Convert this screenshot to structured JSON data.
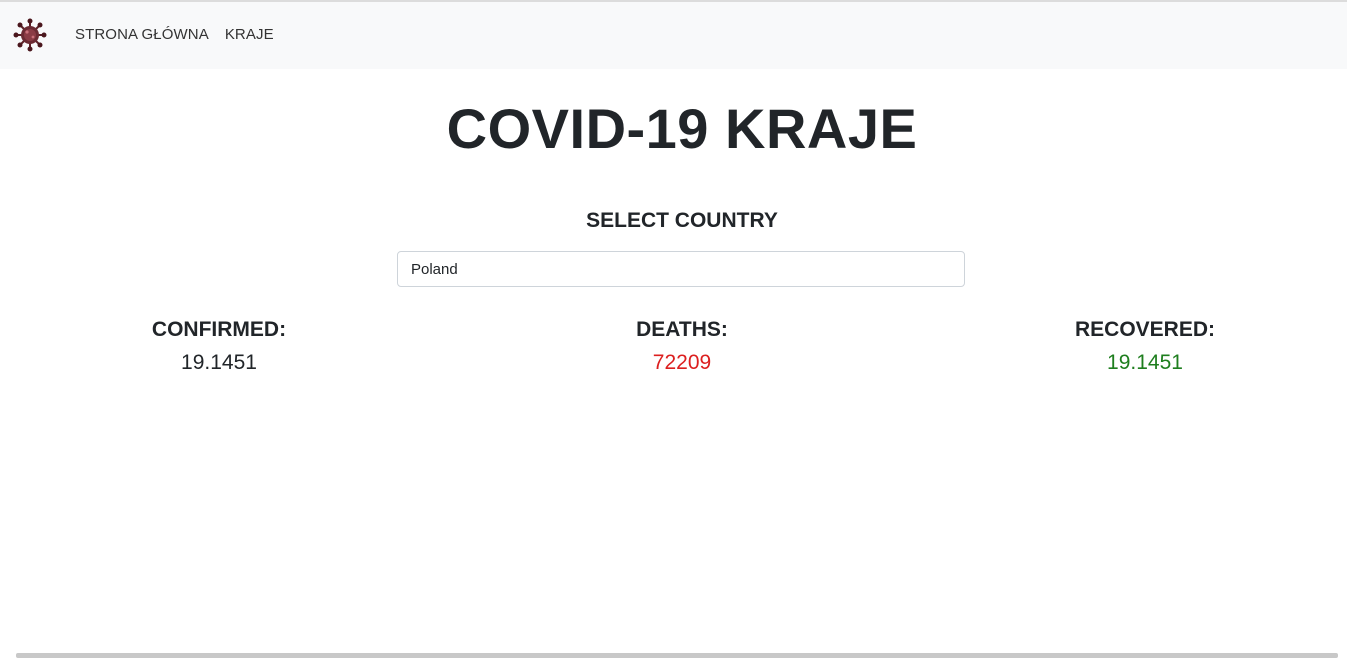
{
  "navbar": {
    "logo_icon": "virus-icon",
    "links": [
      "STRONA GŁÓWNA",
      "KRAJE"
    ]
  },
  "main": {
    "title": "COVID-19 KRAJE",
    "select_label": "SELECT COUNTRY",
    "country_value": "Poland"
  },
  "stats": {
    "confirmed": {
      "label": "CONFIRMED:",
      "value": "19.1451",
      "color": "#212529"
    },
    "deaths": {
      "label": "DEATHS:",
      "value": "72209",
      "color": "#dc1f1f"
    },
    "recovered": {
      "label": "RECOVERED:",
      "value": "19.1451",
      "color": "#1e7e1e"
    }
  }
}
